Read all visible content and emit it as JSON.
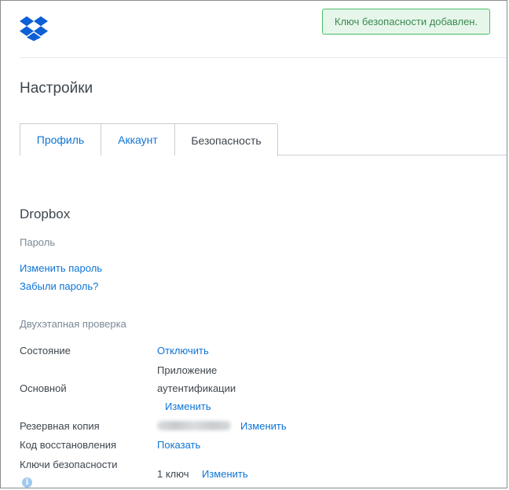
{
  "toast": {
    "message": "Ключ безопасности добавлен."
  },
  "page": {
    "title": "Настройки"
  },
  "tabs": [
    {
      "label": "Профиль",
      "active": false
    },
    {
      "label": "Аккаунт",
      "active": false
    },
    {
      "label": "Безопасность",
      "active": true
    }
  ],
  "section": {
    "title": "Dropbox",
    "password": {
      "heading": "Пароль",
      "change_link": "Изменить пароль",
      "forgot_link": "Забыли пароль?"
    },
    "two_step": {
      "heading": "Двухэтапная проверка",
      "status_label": "Состояние",
      "status_action": "Отключить",
      "primary_label": "Основной",
      "primary_value_line1": "Приложение",
      "primary_value_line2": "аутентификации",
      "primary_action": "Изменить",
      "backup_label": "Резервная копия",
      "backup_action": "Изменить",
      "recovery_label": "Код восстановления",
      "recovery_action": "Показать",
      "keys_label": "Ключи безопасности",
      "keys_value": "1 ключ",
      "keys_action": "Изменить"
    }
  },
  "icons": {
    "logo": "dropbox-logo-icon",
    "info": "info-icon"
  },
  "colors": {
    "accent": "#0d74d6",
    "brand": "#0d5fd6",
    "success_bg": "#e6f6ea",
    "success_border": "#4bbd68"
  }
}
